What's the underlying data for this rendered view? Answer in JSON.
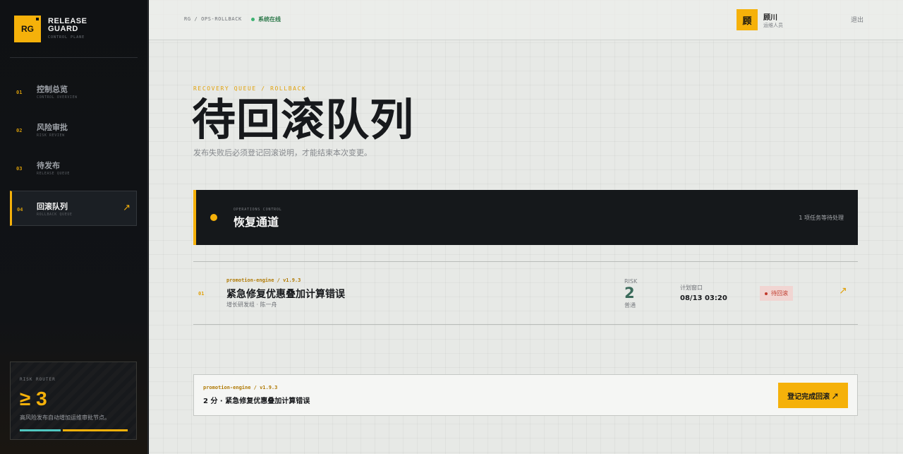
{
  "brand": {
    "logo_text": "RG",
    "name_line1": "RELEASE",
    "name_line2": "GUARD",
    "subtitle": "CONTROL PLANE"
  },
  "sidebar": {
    "items": [
      {
        "num": "01",
        "label": "控制总览",
        "sub": "CONTROL OVERVIEW"
      },
      {
        "num": "02",
        "label": "风险审批",
        "sub": "RISK REVIEW"
      },
      {
        "num": "03",
        "label": "待发布",
        "sub": "RELEASE QUEUE"
      },
      {
        "num": "04",
        "label": "回滚队列",
        "sub": "ROLLBACK QUEUE",
        "arrow": "↗"
      }
    ],
    "risk_card": {
      "title": "RISK ROUTER",
      "value": "≥ 3",
      "desc": "高风险发布自动增加运维审批节点。"
    }
  },
  "topbar": {
    "breadcrumb": "RG / OPS-ROLLBACK",
    "status": "系统在线",
    "status_color": "#3cb371",
    "avatar": "顾",
    "user_name": "顾川",
    "user_role": "运维人员",
    "logout": "退出"
  },
  "header": {
    "kicker": "RECOVERY QUEUE / ROLLBACK",
    "title": "待回滚队列",
    "subtitle": "发布失败后必须登记回滚说明，才能结束本次变更。"
  },
  "panel": {
    "eyebrow": "OPERATIONS CONTROL",
    "title": "恢复通道",
    "count": "1 项任务等待处理"
  },
  "rows": [
    {
      "index": "01",
      "service": "promotion-engine / v1.9.3",
      "name": "紧急修复优惠叠加计算错误",
      "team": "增长研发组 · 陈一舟",
      "risk_label": "RISK",
      "risk_value": "2",
      "risk_level": "普通",
      "window_label": "计划窗口",
      "window_value": "08/13 03:20",
      "status": "待回滚",
      "arrow": "↗"
    }
  ],
  "action": {
    "service": "promotion-engine / v1.9.3",
    "summary": "2 分 · 紧急修复优惠叠加计算错误",
    "button": "登记完成回滚 ↗"
  },
  "colors": {
    "accent": "#f5b10a",
    "danger": "#c0392b",
    "sidebar_bg": "#111316"
  }
}
